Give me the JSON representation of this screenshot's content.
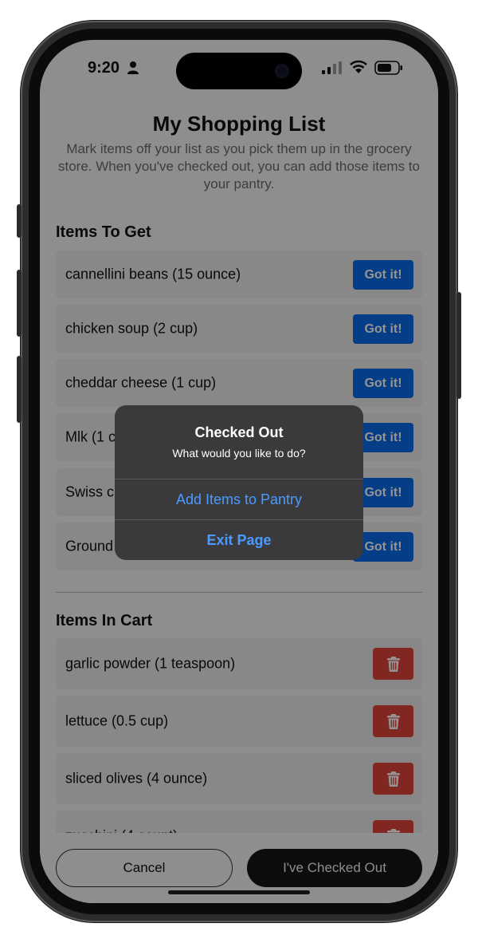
{
  "status_bar": {
    "time": "9:20"
  },
  "header": {
    "title": "My Shopping List",
    "subtitle": "Mark items off your list as you pick them up in the grocery store. When you've checked out, you can add those items to your pantry."
  },
  "items_to_get": {
    "title": "Items To Get",
    "button_label": "Got it!",
    "items": [
      "cannellini beans (15 ounce)",
      "chicken soup (2 cup)",
      "cheddar cheese (1 cup)",
      "Mlk (1 c",
      "Swiss c",
      "Ground"
    ]
  },
  "items_in_cart": {
    "title": "Items In Cart",
    "items": [
      "garlic powder (1 teaspoon)",
      "lettuce (0.5 cup)",
      "sliced olives (4 ounce)",
      "zucchini (4 count)"
    ]
  },
  "footer": {
    "cancel_label": "Cancel",
    "checkout_label": "I've Checked Out"
  },
  "dialog": {
    "title": "Checked Out",
    "message": "What would you like to do?",
    "actions": [
      "Add Items to Pantry",
      "Exit Page"
    ]
  },
  "colors": {
    "primary_button": "#0a6be8",
    "delete_button": "#e0423a",
    "dialog_action": "#4a9bff"
  }
}
